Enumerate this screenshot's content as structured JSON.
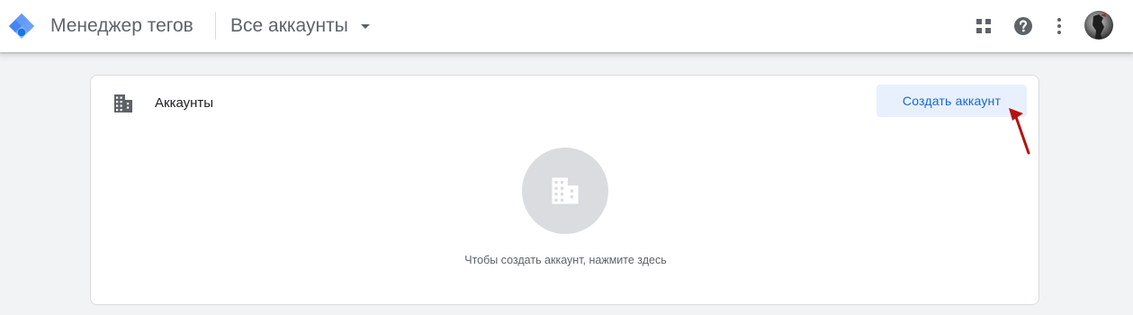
{
  "appbar": {
    "product_name": "Менеджер тегов",
    "account_selector": "Все аккаунты",
    "icons": [
      "apps-icon",
      "help-icon",
      "more-vert-icon",
      "avatar"
    ]
  },
  "card": {
    "title": "Аккаунты",
    "create_button": "Создать аккаунт",
    "empty_state_text": "Чтобы создать аккаунт, нажмите здесь"
  },
  "colors": {
    "accent": "#1967d2",
    "button_bg": "#e8f0fe",
    "annotation_arrow": "#b31412"
  }
}
